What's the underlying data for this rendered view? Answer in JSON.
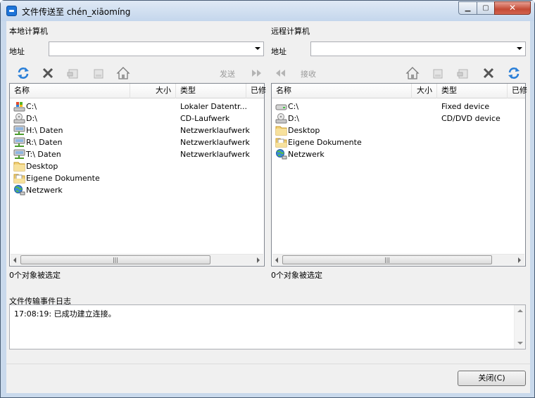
{
  "window": {
    "title": "文件传送至 chén_xiāomíng",
    "controls": {
      "minimize": "▁",
      "maximize": "▢",
      "close": "✕"
    }
  },
  "local": {
    "heading": "本地计算机",
    "address_label": "地址",
    "address_value": "",
    "send_label": "发送",
    "columns": [
      "名称",
      "大小",
      "类型",
      "已修"
    ],
    "rows": [
      {
        "name": "C:\\",
        "type": "Lokaler Datentr...",
        "icon": "windows-drive-icon"
      },
      {
        "name": "D:\\",
        "type": "CD-Laufwerk",
        "icon": "cd-drive-icon"
      },
      {
        "name": "H:\\ Daten",
        "type": "Netzwerklaufwerk",
        "icon": "network-drive-icon"
      },
      {
        "name": "R:\\ Daten",
        "type": "Netzwerklaufwerk",
        "icon": "network-drive-icon"
      },
      {
        "name": "T:\\ Daten",
        "type": "Netzwerklaufwerk",
        "icon": "network-drive-icon"
      },
      {
        "name": "Desktop",
        "type": "",
        "icon": "folder-icon"
      },
      {
        "name": "Eigene Dokumente",
        "type": "",
        "icon": "documents-folder-icon"
      },
      {
        "name": "Netzwerk",
        "type": "",
        "icon": "network-globe-icon"
      }
    ],
    "status": "0个对象被选定"
  },
  "remote": {
    "heading": "远程计算机",
    "address_label": "地址",
    "address_value": "",
    "receive_label": "接收",
    "columns": [
      "名称",
      "大小",
      "类型",
      "已修"
    ],
    "rows": [
      {
        "name": "C:\\",
        "type": "Fixed device",
        "icon": "hard-drive-icon"
      },
      {
        "name": "D:\\",
        "type": "CD/DVD device",
        "icon": "cd-drive-icon"
      },
      {
        "name": "Desktop",
        "type": "",
        "icon": "folder-icon"
      },
      {
        "name": "Eigene Dokumente",
        "type": "",
        "icon": "documents-folder-icon"
      },
      {
        "name": "Netzwerk",
        "type": "",
        "icon": "network-globe-icon"
      }
    ],
    "status": "0个对象被选定"
  },
  "log": {
    "heading": "文件传输事件日志",
    "entries": [
      "17:08:19: 已成功建立连接。"
    ]
  },
  "footer": {
    "close_label": "关闭(C)"
  },
  "colors": {
    "refresh": "#2a7fd8",
    "delete": "#555555",
    "title_bg": "#c4d6ec"
  }
}
